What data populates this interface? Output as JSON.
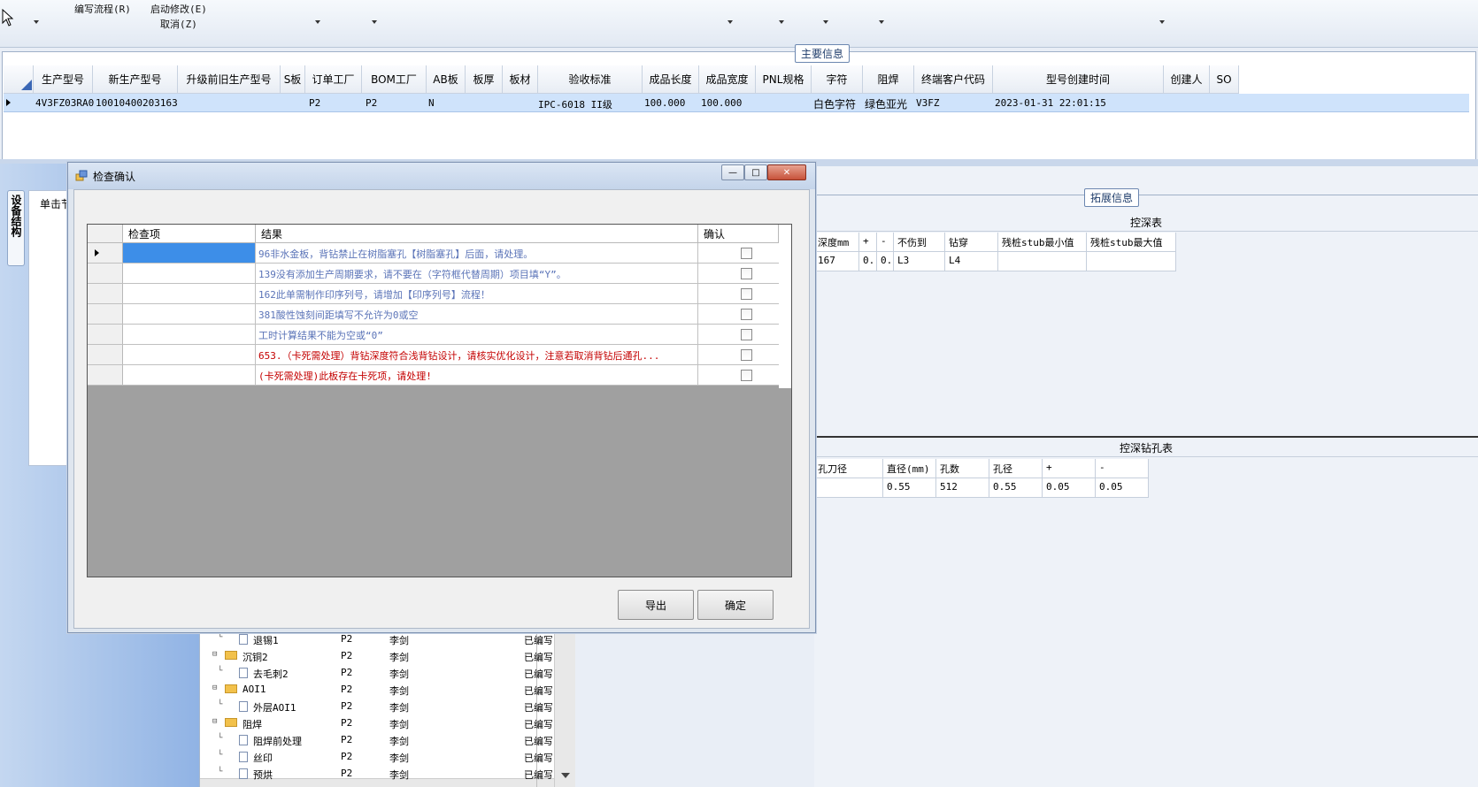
{
  "menubar": {
    "items": [
      {
        "label": "编写流程(R)"
      },
      {
        "label": "启动修改(E)"
      },
      {
        "label": "取消(Z)"
      }
    ]
  },
  "main_info": {
    "title": "主要信息",
    "columns": [
      "生产型号",
      "新生产型号",
      "升级前旧生产型号",
      "S板",
      "订单工厂",
      "BOM工厂",
      "AB板",
      "板厚",
      "板材",
      "验收标准",
      "成品长度",
      "成品宽度",
      "PNL规格",
      "字符",
      "阻焊",
      "终端客户代码",
      "型号创建时间",
      "创建人",
      "SO"
    ],
    "row": {
      "生产型号": "4V3FZ03RA0",
      "新生产型号": "10010400203163",
      "订单工厂": "P2",
      "BOM工厂": "P2",
      "AB板": "N",
      "验收标准": "IPC-6018 II级",
      "成品长度": "100.000",
      "成品宽度": "100.000",
      "字符": "白色字符",
      "阻焊": "绿色亚光",
      "终端客户代码": "V3FZ",
      "型号创建时间": "2023-01-31 22:01:15"
    }
  },
  "left_panel": {
    "vertical_tab": "设备结构",
    "click_label": "单击节"
  },
  "extended_info": {
    "title": "拓展信息",
    "depth_table": {
      "title": "控深表",
      "headers": [
        "深度mm",
        "+",
        "-",
        "不伤到",
        "钻穿",
        "残桩stub最小值",
        "残桩stub最大值"
      ],
      "row": [
        "167",
        "0..",
        "0..",
        "L3",
        "L4",
        "",
        ""
      ]
    },
    "drill_table": {
      "title": "控深钻孔表",
      "headers": [
        "孔刀径",
        "直径(mm)",
        "孔数",
        "孔径",
        "+",
        "-"
      ],
      "row": [
        "",
        "0.55",
        "512",
        "0.55",
        "0.05",
        "0.05"
      ]
    }
  },
  "tree": {
    "rows": [
      {
        "label": "退锡1",
        "kind": "doc",
        "factory": "P2",
        "user": "李剑",
        "status": "已编写"
      },
      {
        "label": "沉铜2",
        "kind": "folder",
        "factory": "P2",
        "user": "李剑",
        "status": "已编写"
      },
      {
        "label": "去毛刺2",
        "kind": "doc",
        "factory": "P2",
        "user": "李剑",
        "status": "已编写"
      },
      {
        "label": "AOI1",
        "kind": "folder",
        "factory": "P2",
        "user": "李剑",
        "status": "已编写"
      },
      {
        "label": "外层AOI1",
        "kind": "doc",
        "factory": "P2",
        "user": "李剑",
        "status": "已编写"
      },
      {
        "label": "阻焊",
        "kind": "folder",
        "factory": "P2",
        "user": "李剑",
        "status": "已编写"
      },
      {
        "label": "阻焊前处理",
        "kind": "doc",
        "factory": "P2",
        "user": "李剑",
        "status": "已编写"
      },
      {
        "label": "丝印",
        "kind": "doc",
        "factory": "P2",
        "user": "李剑",
        "status": "已编写"
      },
      {
        "label": "预烘",
        "kind": "doc",
        "factory": "P2",
        "user": "李剑",
        "status": "已编写"
      }
    ]
  },
  "dialog": {
    "title": "检查确认",
    "columns": {
      "item": "检查项",
      "result": "结果",
      "confirm": "确认"
    },
    "rows": [
      {
        "result": "96非水金板，背钻禁止在树脂塞孔【树脂塞孔】后面，请处理。",
        "color": "#5b74b8"
      },
      {
        "result": "139没有添加生产周期要求，请不要在（字符框代替周期）项目填“Y”。",
        "color": "#5b74b8"
      },
      {
        "result": "162此单需制作印序列号，请增加【印序列号】流程！",
        "color": "#5b74b8"
      },
      {
        "result": "381酸性蚀刻间距填写不允许为0或空",
        "color": "#5b74b8"
      },
      {
        "result": "工时计算结果不能为空或“0”",
        "color": "#5b74b8"
      },
      {
        "result": "653.（卡死需处理）背钻深度符合浅背钻设计，请核实优化设计，注意若取消背钻后通孔...",
        "color": "#c40000"
      },
      {
        "result": "(卡死需处理)此板存在卡死项，请处理!",
        "color": "#c40000"
      }
    ],
    "export_label": "导出",
    "ok_label": "确定"
  },
  "colors": {
    "selection": "#cfe3fb",
    "info_text": "#5b74b8",
    "error_text": "#c40000"
  }
}
